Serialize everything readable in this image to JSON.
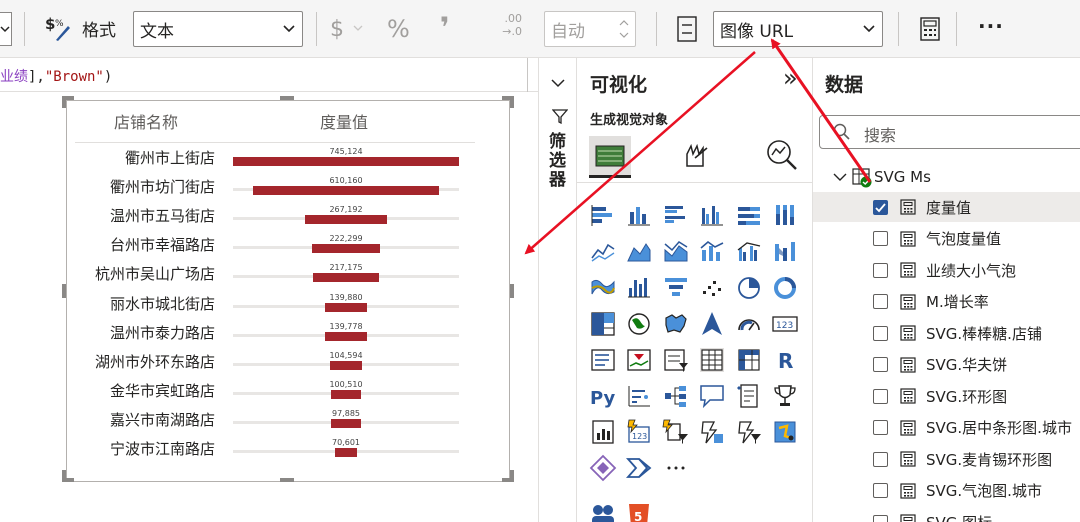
{
  "ribbon": {
    "format_label": "格式",
    "format_value": "文本",
    "currency_symbol": "$",
    "percent_symbol": "%",
    "comma_symbol": "❜",
    "decimal_top": ".00",
    "decimal_bottom": "→.0",
    "auto_value": "自动",
    "category_value": "图像 URL",
    "more_label": "···"
  },
  "formula": {
    "text_part1": "业绩",
    "text_part2": "],",
    "text_part3": "\"Brown\"",
    "text_part4": ")"
  },
  "visual": {
    "col_store": "店铺名称",
    "col_measure": "度量值",
    "rows": [
      {
        "store": "衢州市上街店",
        "value": 745124,
        "label": "745,124"
      },
      {
        "store": "衢州市坊门街店",
        "value": 610160,
        "label": "610,160"
      },
      {
        "store": "温州市五马街店",
        "value": 267192,
        "label": "267,192"
      },
      {
        "store": "台州市幸福路店",
        "value": 222299,
        "label": "222,299"
      },
      {
        "store": "杭州市吴山广场店",
        "value": 217175,
        "label": "217,175"
      },
      {
        "store": "丽水市城北街店",
        "value": 139880,
        "label": "139,880"
      },
      {
        "store": "温州市泰力路店",
        "value": 139778,
        "label": "139,778"
      },
      {
        "store": "湖州市外环东路店",
        "value": 104594,
        "label": "104,594"
      },
      {
        "store": "金华市宾虹路店",
        "value": 100510,
        "label": "100,510"
      },
      {
        "store": "嘉兴市南湖路店",
        "value": 97885,
        "label": "97,885"
      },
      {
        "store": "宁波市江南路店",
        "value": 70601,
        "label": "70,601"
      }
    ],
    "bar_color": "#a4262c"
  },
  "filters": {
    "label": "筛选器"
  },
  "viz_pane": {
    "title": "可视化",
    "subtitle": "生成视觉对象",
    "collapse": "»"
  },
  "data_pane": {
    "title": "数据",
    "search_placeholder": "搜索",
    "table_name": "SVG Ms",
    "fields": [
      {
        "name": "度量值",
        "checked": true
      },
      {
        "name": "气泡度量值",
        "checked": false
      },
      {
        "name": "业绩大小气泡",
        "checked": false
      },
      {
        "name": "M.增长率",
        "checked": false
      },
      {
        "name": "SVG.棒棒糖.店铺",
        "checked": false
      },
      {
        "name": "SVG.华夫饼",
        "checked": false
      },
      {
        "name": "SVG.环形图",
        "checked": false
      },
      {
        "name": "SVG.居中条形图.城市",
        "checked": false
      },
      {
        "name": "SVG.麦肯锡环形图",
        "checked": false
      },
      {
        "name": "SVG.气泡图.城市",
        "checked": false
      },
      {
        "name": "SVG.图标",
        "checked": false
      }
    ]
  },
  "accent": "#e81123"
}
